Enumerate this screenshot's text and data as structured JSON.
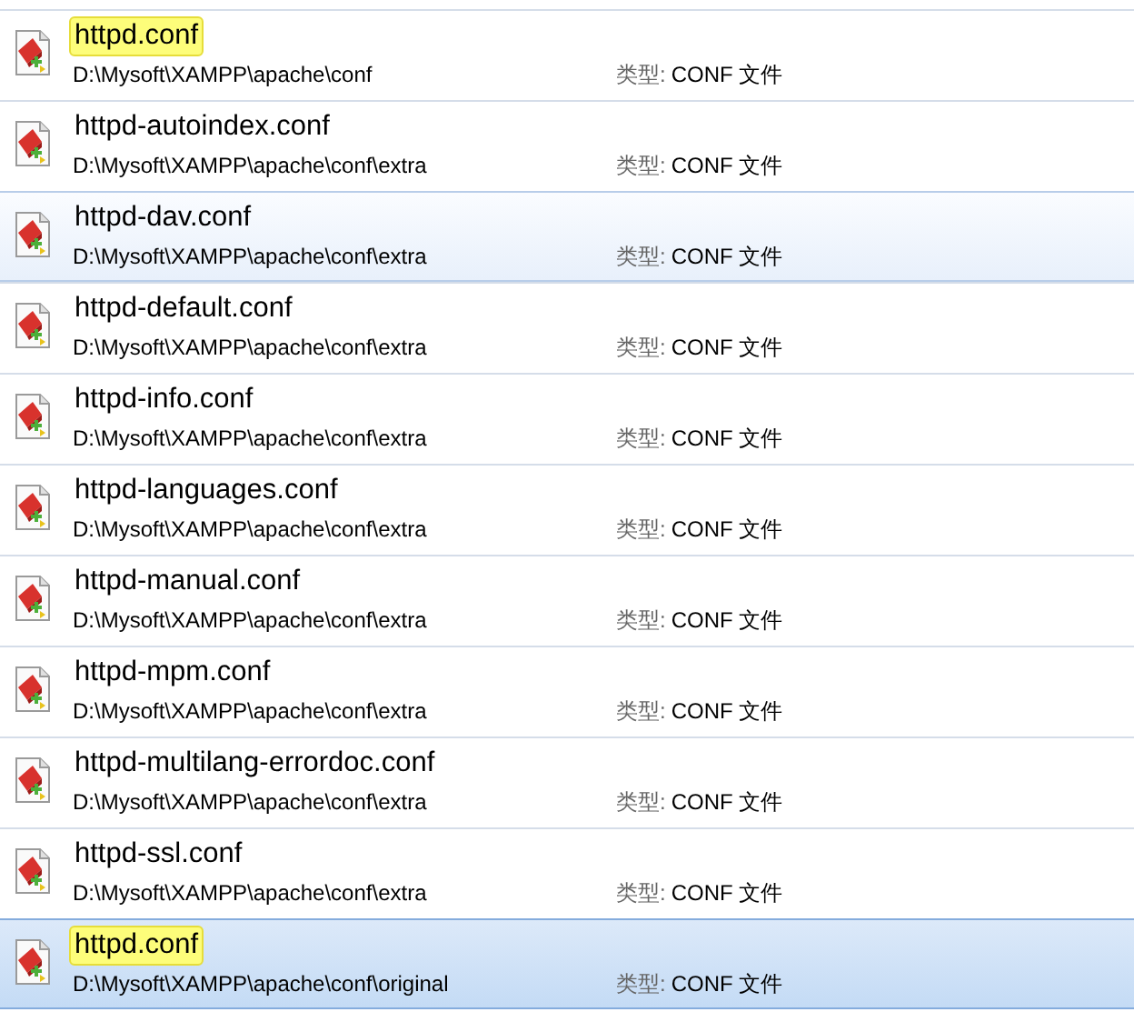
{
  "results": [
    {
      "name": "httpd.conf",
      "highlighted": true,
      "path": "D:\\Mysoft\\XAMPP\\apache\\conf",
      "type_label": "类型:",
      "type_value": "CONF 文件",
      "selected": false,
      "hovered": false
    },
    {
      "name": "httpd-autoindex.conf",
      "highlighted": false,
      "path": "D:\\Mysoft\\XAMPP\\apache\\conf\\extra",
      "type_label": "类型:",
      "type_value": "CONF 文件",
      "selected": false,
      "hovered": false
    },
    {
      "name": "httpd-dav.conf",
      "highlighted": false,
      "path": "D:\\Mysoft\\XAMPP\\apache\\conf\\extra",
      "type_label": "类型:",
      "type_value": "CONF 文件",
      "selected": false,
      "hovered": true
    },
    {
      "name": "httpd-default.conf",
      "highlighted": false,
      "path": "D:\\Mysoft\\XAMPP\\apache\\conf\\extra",
      "type_label": "类型:",
      "type_value": "CONF 文件",
      "selected": false,
      "hovered": false
    },
    {
      "name": "httpd-info.conf",
      "highlighted": false,
      "path": "D:\\Mysoft\\XAMPP\\apache\\conf\\extra",
      "type_label": "类型:",
      "type_value": "CONF 文件",
      "selected": false,
      "hovered": false
    },
    {
      "name": "httpd-languages.conf",
      "highlighted": false,
      "path": "D:\\Mysoft\\XAMPP\\apache\\conf\\extra",
      "type_label": "类型:",
      "type_value": "CONF 文件",
      "selected": false,
      "hovered": false
    },
    {
      "name": "httpd-manual.conf",
      "highlighted": false,
      "path": "D:\\Mysoft\\XAMPP\\apache\\conf\\extra",
      "type_label": "类型:",
      "type_value": "CONF 文件",
      "selected": false,
      "hovered": false
    },
    {
      "name": "httpd-mpm.conf",
      "highlighted": false,
      "path": "D:\\Mysoft\\XAMPP\\apache\\conf\\extra",
      "type_label": "类型:",
      "type_value": "CONF 文件",
      "selected": false,
      "hovered": false
    },
    {
      "name": "httpd-multilang-errordoc.conf",
      "highlighted": false,
      "path": "D:\\Mysoft\\XAMPP\\apache\\conf\\extra",
      "type_label": "类型:",
      "type_value": "CONF 文件",
      "selected": false,
      "hovered": false
    },
    {
      "name": "httpd-ssl.conf",
      "highlighted": false,
      "path": "D:\\Mysoft\\XAMPP\\apache\\conf\\extra",
      "type_label": "类型:",
      "type_value": "CONF 文件",
      "selected": false,
      "hovered": false
    },
    {
      "name": "httpd.conf",
      "highlighted": true,
      "path": "D:\\Mysoft\\XAMPP\\apache\\conf\\original",
      "type_label": "类型:",
      "type_value": "CONF 文件",
      "selected": true,
      "hovered": false
    }
  ]
}
